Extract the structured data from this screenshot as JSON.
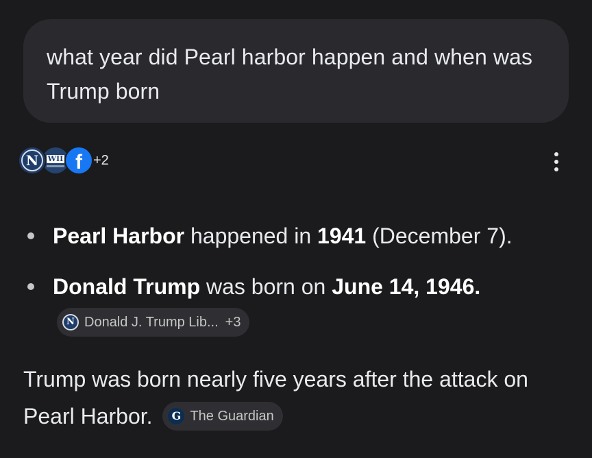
{
  "user_prompt": {
    "text": "what year did Pearl harbor happen and when was Trump born"
  },
  "sources": {
    "favicons": [
      "nps-icon",
      "wwii-museum-icon",
      "facebook-icon"
    ],
    "extra_count": "+2"
  },
  "answer": {
    "items": [
      {
        "bold_1": "Pearl Harbor",
        "text_1": " happened in ",
        "bold_2": "1941",
        "text_2": " (December 7)."
      },
      {
        "bold_1": "Donald Trump",
        "text_1": " was born on ",
        "bold_2": "June 14, 1946.",
        "citation": {
          "label": "Donald J. Trump Lib...",
          "extra": "+3"
        }
      }
    ],
    "summary_text": "Trump was born nearly five years after the attack on Pearl Harbor.",
    "summary_citation": {
      "label": "The Guardian"
    }
  },
  "colors": {
    "background": "#1b1b1d",
    "bubble": "#2a2a2e",
    "chip": "#2f2f33",
    "text": "#e8eaed",
    "facebook": "#1877f2"
  }
}
